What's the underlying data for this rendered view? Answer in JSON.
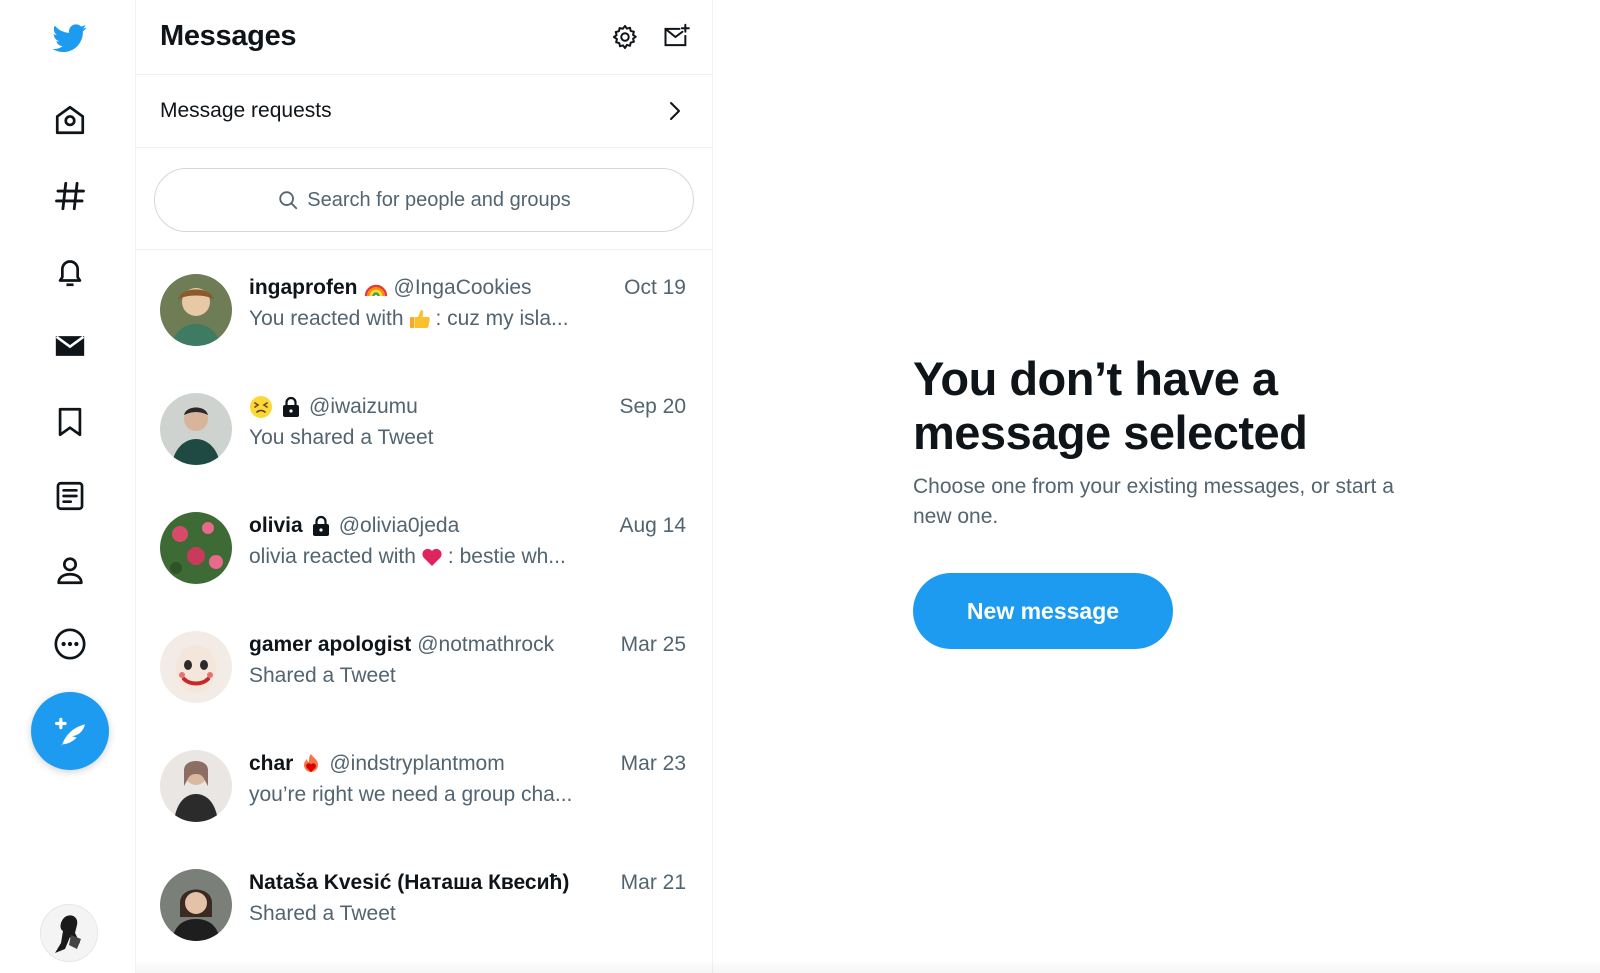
{
  "colors": {
    "brand": "#1d9bf0",
    "text": "#0f1419",
    "muted": "#536471",
    "border": "#eff3f4"
  },
  "nav": {
    "items": [
      {
        "icon": "twitter-bird-icon"
      },
      {
        "icon": "home-icon"
      },
      {
        "icon": "explore-hashtag-icon"
      },
      {
        "icon": "notifications-bell-icon"
      },
      {
        "icon": "messages-envelope-icon"
      },
      {
        "icon": "bookmark-icon"
      },
      {
        "icon": "lists-icon"
      },
      {
        "icon": "profile-icon"
      },
      {
        "icon": "more-icon"
      }
    ],
    "compose_icon": "compose-feather-icon"
  },
  "messages": {
    "title": "Messages",
    "settings_icon": "gear-icon",
    "new_message_icon": "new-message-envelope-icon",
    "requests_label": "Message requests",
    "search_placeholder": "Search for people and groups"
  },
  "conversations": [
    {
      "name": "ingaprofen",
      "name_emoji": "rainbow",
      "handle": "@IngaCookies",
      "date": "Oct 19",
      "preview_before": "You reacted with",
      "preview_emoji": "thumbs-up",
      "preview_after": ": cuz my isla..."
    },
    {
      "name": "",
      "name_emoji": "persevering-face",
      "lock": true,
      "handle": "@iwaizumu",
      "date": "Sep 20",
      "preview_before": "You shared a Tweet",
      "preview_emoji": "",
      "preview_after": ""
    },
    {
      "name": "olivia",
      "lock": true,
      "handle": "@olivia0jeda",
      "date": "Aug 14",
      "preview_before": "olivia reacted with",
      "preview_emoji": "red-heart",
      "preview_after": ": bestie wh..."
    },
    {
      "name": "gamer apologist",
      "handle": "@notmathrock",
      "date": "Mar 25",
      "preview_before": "Shared a Tweet",
      "preview_emoji": "",
      "preview_after": ""
    },
    {
      "name": "char",
      "name_emoji": "heart-on-fire",
      "handle": "@indstryplantmom",
      "date": "Mar 23",
      "preview_before": "you’re right we need a group cha...",
      "preview_emoji": "",
      "preview_after": ""
    },
    {
      "name": "Nataša Kvesić (Наташа Квесић)",
      "handle": "",
      "date": "Mar 21",
      "preview_before": "Shared a Tweet",
      "preview_emoji": "",
      "preview_after": ""
    }
  ],
  "empty_state": {
    "title": "You don’t have a message selected",
    "subtitle": "Choose one from your existing messages, or start a new one.",
    "button": "New message"
  }
}
